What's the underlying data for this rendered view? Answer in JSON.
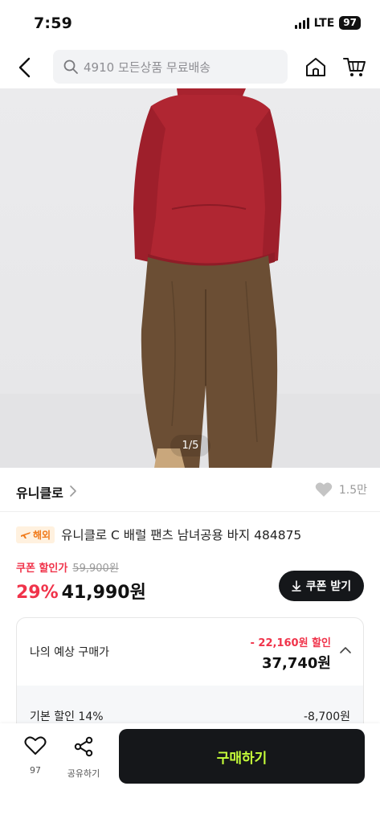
{
  "status_bar": {
    "time": "7:59",
    "network": "LTE",
    "battery": "97"
  },
  "header": {
    "search_placeholder": "4910 모든상품 무료배송"
  },
  "product_image": {
    "pager": "1/5"
  },
  "brand": {
    "name": "유니클로",
    "like_count": "1.5만"
  },
  "product": {
    "badge": "해외",
    "title": "유니클로 C 배럴 팬츠 남녀공용 바지 484875"
  },
  "price": {
    "coupon_label": "쿠폰 할인가",
    "original_price": "59,900원",
    "discount_rate": "29%",
    "sale_price": "41,990원",
    "coupon_button": "쿠폰 받기"
  },
  "expected_price": {
    "label": "나의 예상 구매가",
    "discount": "- 22,160원 할인",
    "price": "37,740원",
    "base_discount_label": "기본 할인 14%",
    "base_discount_amount": "-8,700원"
  },
  "bottom_bar": {
    "like_count": "97",
    "share_label": "공유하기",
    "buy_label": "구매하기"
  },
  "colors": {
    "accent_red": "#f0334a",
    "button_dark": "#15171a",
    "buy_text": "#c6ff3a",
    "hoodie": "#b02632",
    "pants": "#6b4e34"
  }
}
